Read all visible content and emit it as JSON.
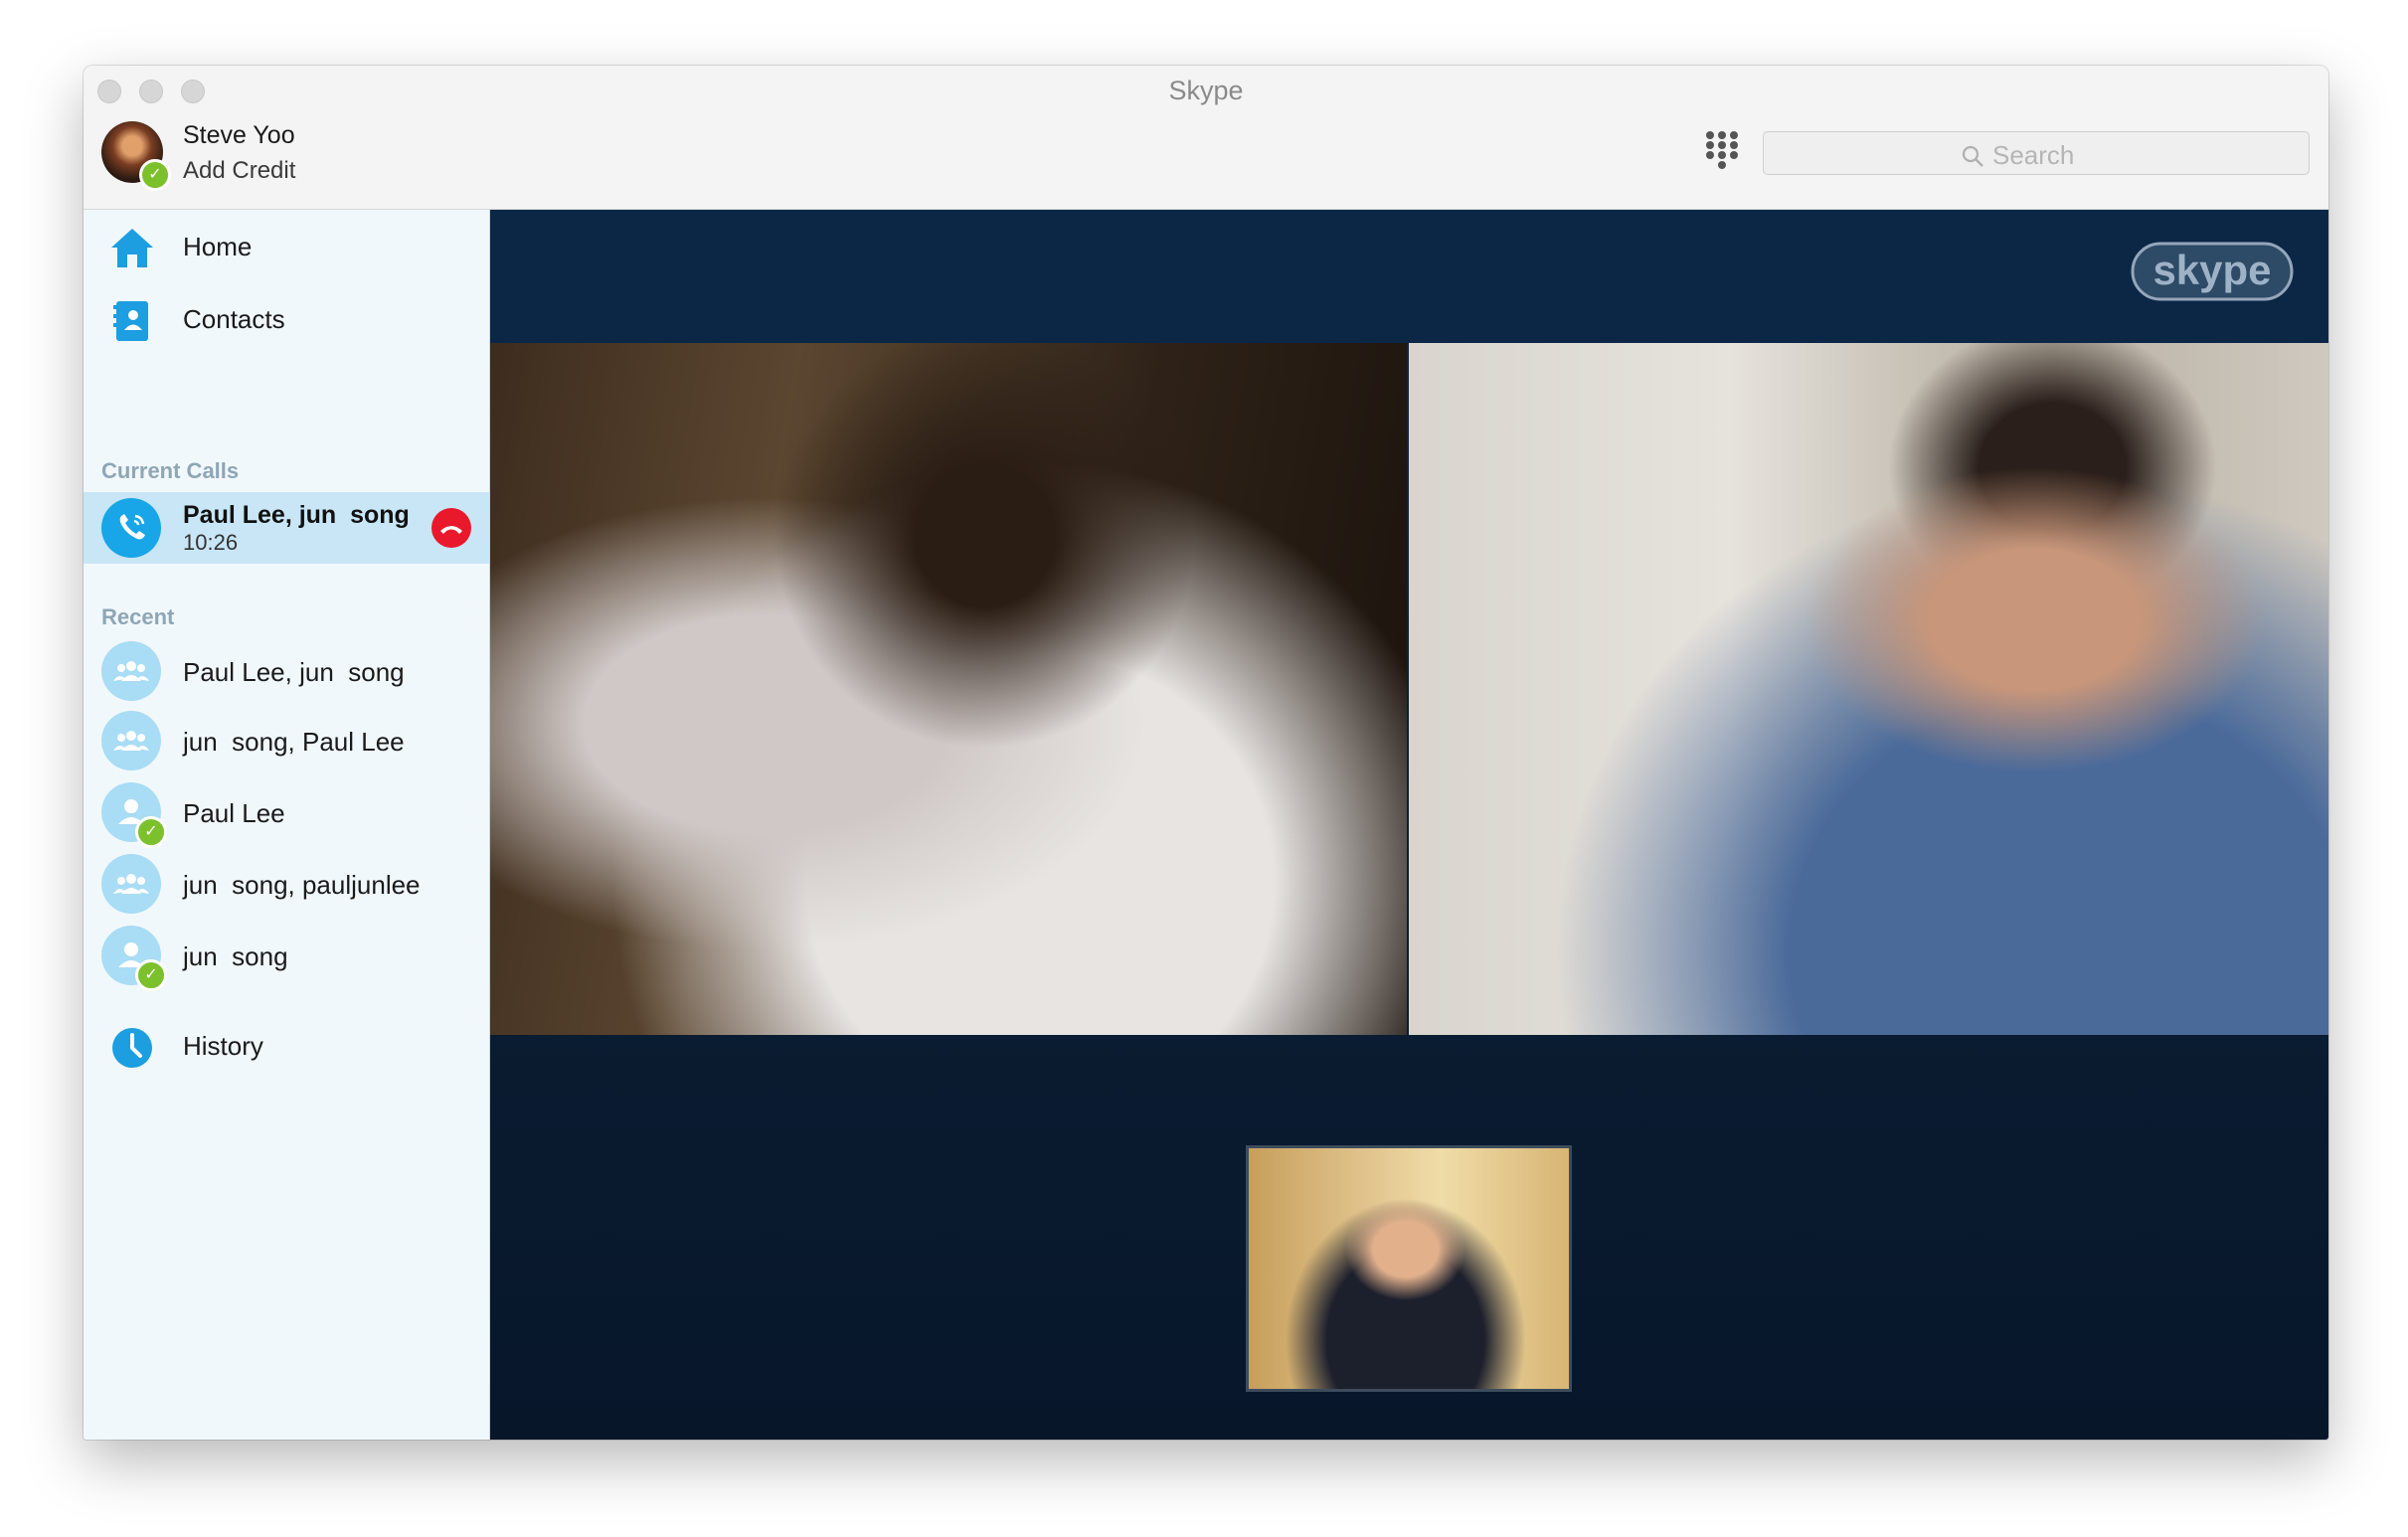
{
  "window": {
    "title": "Skype"
  },
  "profile": {
    "name": "Steve Yoo",
    "credit": "Add Credit"
  },
  "search": {
    "placeholder": "Search"
  },
  "nav": {
    "home": "Home",
    "contacts": "Contacts",
    "history": "History"
  },
  "current_calls": {
    "heading": "Current Calls",
    "call": {
      "name": "Paul Lee, jun  song",
      "duration": "10:26"
    }
  },
  "recent": {
    "heading": "Recent",
    "items": [
      {
        "label": "Paul Lee, jun  song",
        "type": "group",
        "online": false
      },
      {
        "label": "jun  song, Paul Lee",
        "type": "group",
        "online": false
      },
      {
        "label": "Paul Lee",
        "type": "person",
        "online": true
      },
      {
        "label": "jun  song, pauljunlee",
        "type": "group",
        "online": false
      },
      {
        "label": "jun  song",
        "type": "person",
        "online": true
      }
    ]
  },
  "brand": {
    "logo_text": "skype"
  },
  "colors": {
    "accent": "#18a6e8",
    "hangup": "#e9192b",
    "online": "#7cc02c",
    "stage": "#0c2746"
  }
}
